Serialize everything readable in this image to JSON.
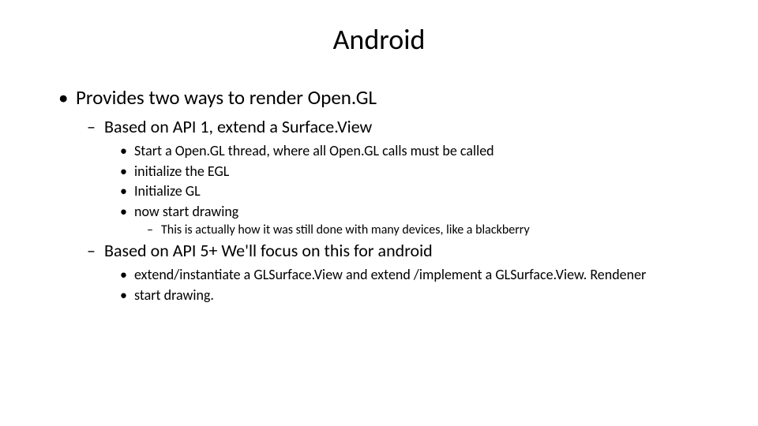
{
  "title": "Android",
  "bullet1": "Provides two ways to render Open.GL",
  "bullet1_1": "Based on API 1, extend a Surface.View",
  "bullet1_1_1": "Start a Open.GL thread, where all Open.GL calls must be called",
  "bullet1_1_2": "initialize the EGL",
  "bullet1_1_3": "Initialize GL",
  "bullet1_1_4": "now start drawing",
  "bullet1_1_4_1": "This is actually how it was still done with many devices, like a blackberry",
  "bullet1_2": "Based on  API 5+   We'll focus on this for android",
  "bullet1_2_1": "extend/instantiate a GLSurface.View and extend /implement a GLSurface.View. Rendener",
  "bullet1_2_2": "start drawing."
}
